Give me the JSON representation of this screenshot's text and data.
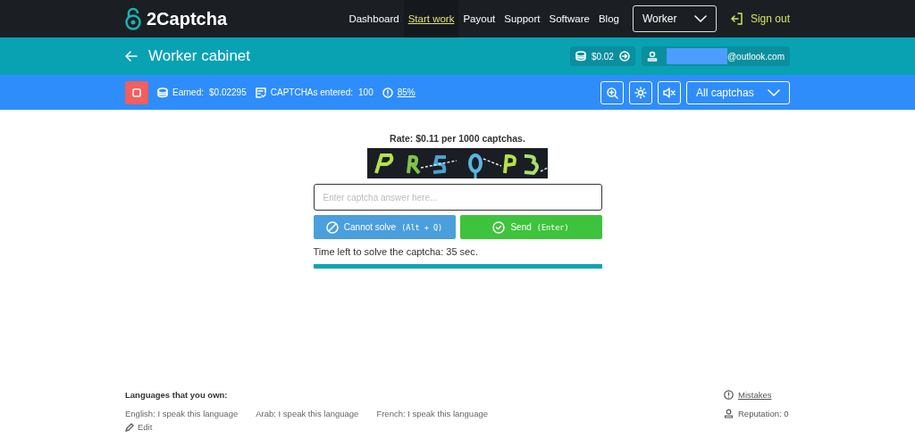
{
  "brand": {
    "name": "2Captcha"
  },
  "nav": [
    {
      "label": "Dashboard",
      "selected": false
    },
    {
      "label": "Start work",
      "selected": true
    },
    {
      "label": "Payout",
      "selected": false
    },
    {
      "label": "Support",
      "selected": false
    },
    {
      "label": "Software",
      "selected": false
    },
    {
      "label": "Blog",
      "selected": false
    }
  ],
  "role_select": {
    "value": "Worker"
  },
  "sign_out": {
    "label": "Sign out"
  },
  "header": {
    "title": "Worker cabinet",
    "balance": "$0.02",
    "email": "@outlook.com"
  },
  "stats": {
    "earned_label": "Earned:",
    "earned": "$0.02295",
    "entered_label": "CAPTCHAs entered:",
    "entered": "100",
    "accuracy": "85%"
  },
  "filter_select": {
    "value": "All captchas"
  },
  "task": {
    "rate": "Rate: $0.11 per 1000 captchas.",
    "answer_placeholder": "Enter captcha answer here...",
    "cannot_solve": "Cannot solve",
    "cannot_solve_key": "(Alt + Q)",
    "send": "Send",
    "send_key": "(Enter)",
    "time_left": "Time left to solve the captcha: 35 sec.",
    "level": 1
  },
  "languages": {
    "title": "Languages that you own:",
    "items": [
      "English: I speak this language",
      "Arab: I speak this language",
      "French: I speak this language"
    ],
    "edit": "Edit"
  },
  "side_links": {
    "mistakes": "Mistakes",
    "reputation": "Reputation: 0"
  }
}
